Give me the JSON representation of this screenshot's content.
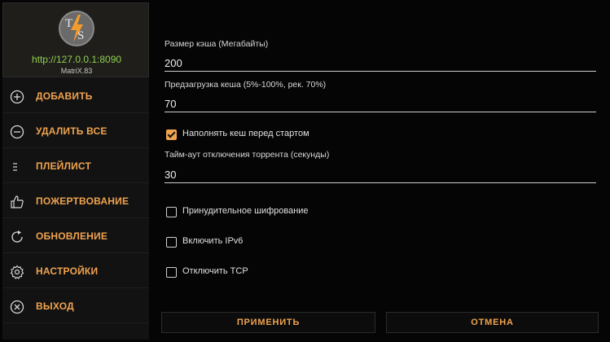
{
  "server": {
    "url": "http://127.0.0.1:8090",
    "name": "MatriX.83",
    "logo_icon": "torrserver-logo"
  },
  "menu": [
    {
      "label": "ДОБАВИТЬ",
      "icon": "plus-circle-icon"
    },
    {
      "label": "УДАЛИТЬ ВСЕ",
      "icon": "minus-circle-icon"
    },
    {
      "label": "ПЛЕЙЛИСТ",
      "icon": "list-icon"
    },
    {
      "label": "ПОЖЕРТВОВАНИЕ",
      "icon": "thumbs-up-icon"
    },
    {
      "label": "ОБНОВЛЕНИЕ",
      "icon": "refresh-icon"
    },
    {
      "label": "НАСТРОЙКИ",
      "icon": "gear-icon"
    },
    {
      "label": "ВЫХОД",
      "icon": "close-circle-icon"
    }
  ],
  "settings": {
    "cache_size": {
      "label": "Размер кэша (Мегабайты)",
      "value": "200"
    },
    "preload": {
      "label": "Предзагрузка кеша (5%-100%, рек. 70%)",
      "value": "70"
    },
    "fill_cache": {
      "label": "Наполнять кеш перед стартом",
      "checked": true
    },
    "timeout": {
      "label": "Тайм-аут отключения торрента (секунды)",
      "value": "30"
    },
    "force_encrypt": {
      "label": "Принудительное шифрование",
      "checked": false
    },
    "ipv6": {
      "label": "Включить IPv6",
      "checked": false
    },
    "disable_tcp": {
      "label": "Отключить TCP",
      "checked": false
    }
  },
  "buttons": {
    "apply": "ПРИМЕНИТЬ",
    "cancel": "ОТМЕНА"
  },
  "colors": {
    "accent": "#f0a34f",
    "url": "#8fd14f",
    "background": "#050505"
  }
}
